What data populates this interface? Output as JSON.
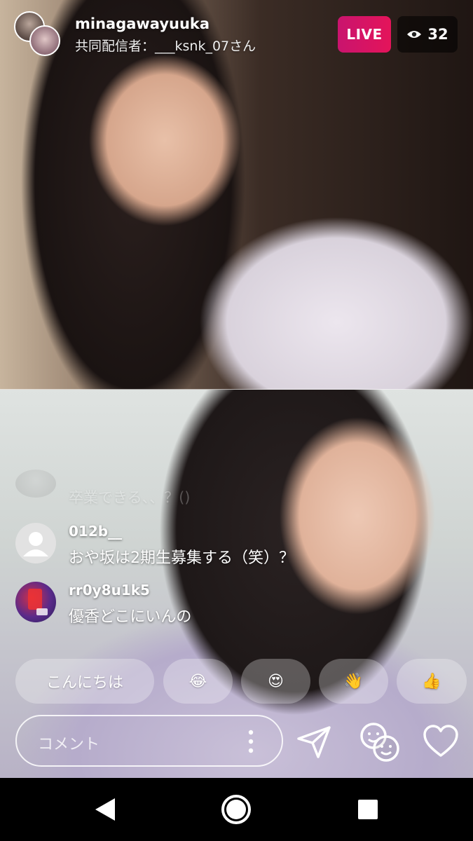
{
  "header": {
    "host_name": "minagawayuuka",
    "cohost_label": "共同配信者：___ksnk_07さん",
    "live_badge": "LIVE",
    "viewer_count": "32"
  },
  "comments": [
    {
      "user": "",
      "text": "卒業できる、、？()",
      "faded": true
    },
    {
      "user": "012b__",
      "text": "おや坂は2期生募集する（笑）？"
    },
    {
      "user": "rr0y8u1k5",
      "text": "優香どこにいんの"
    }
  ],
  "quick_reactions": [
    {
      "label": "こんにちは"
    },
    {
      "label": "😂"
    },
    {
      "label": "😍"
    },
    {
      "label": "👋"
    },
    {
      "label": "👍"
    }
  ],
  "comment_input": {
    "placeholder": "コメント"
  },
  "colors": {
    "live": "#e4145a",
    "overlay": "#ffffff"
  },
  "icons": {
    "viewers": "eye-icon",
    "send": "paper-plane-icon",
    "faces": "faces-icon",
    "like": "heart-icon",
    "more": "vertical-dots-icon",
    "back": "back-triangle-icon",
    "home": "home-circle-icon",
    "recents": "recents-square-icon"
  }
}
